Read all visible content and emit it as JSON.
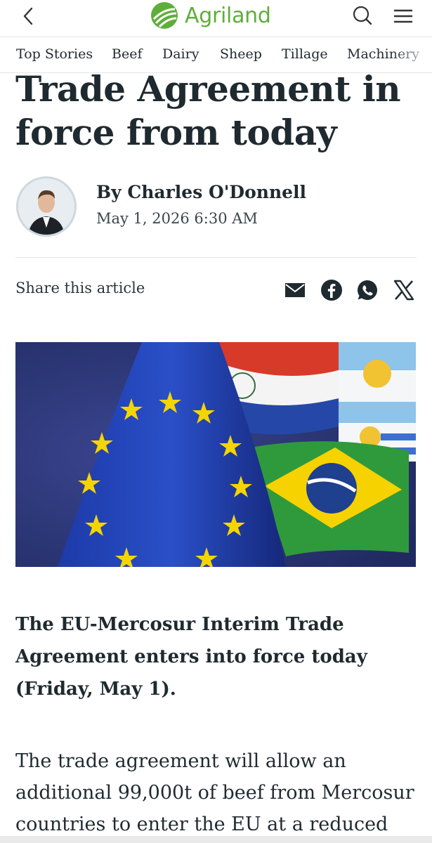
{
  "header": {
    "brand": "Agriland",
    "brand_color": "#5fae3a",
    "back_icon": "chevron-left-icon",
    "search_icon": "search-icon",
    "menu_icon": "hamburger-menu-icon"
  },
  "nav": {
    "items": [
      "Top Stories",
      "Beef",
      "Dairy",
      "Sheep",
      "Tillage",
      "Machinery"
    ]
  },
  "article": {
    "title": "Trade Agreement in force from today",
    "author": "By Charles O'Donnell",
    "date": "May 1, 2026 6:30 AM",
    "share_label": "Share this article",
    "share_icons": [
      "email-icon",
      "facebook-icon",
      "whatsapp-icon",
      "x-icon"
    ],
    "lead": "The EU-Mercosur Interim Trade Agreement enters into force today (Friday, May 1).",
    "paragraph": "The trade agreement will allow an additional 99,000t of beef from Mercosur countries to enter the EU at a reduced"
  }
}
